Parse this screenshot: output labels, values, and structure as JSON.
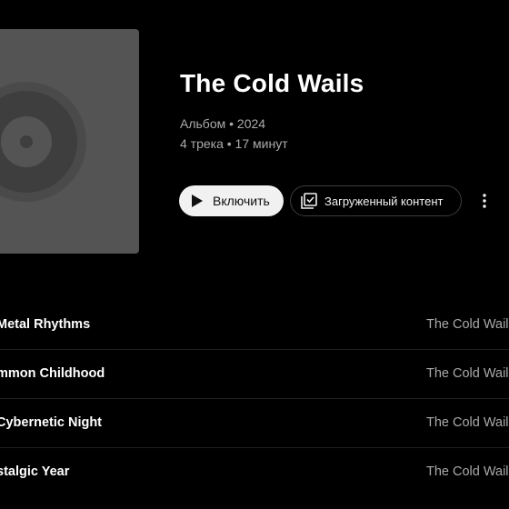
{
  "album": {
    "title": "The Cold Wails",
    "meta_line1": "Альбом • 2024",
    "meta_line2": "4 трека • 17 минут",
    "cover_icon": "vinyl-record-icon"
  },
  "actions": {
    "play_label": "Включить",
    "play_icon": "play-icon",
    "downloaded_label": "Загруженный контент",
    "downloaded_icon": "library-check-icon",
    "more_icon": "more-vertical-icon"
  },
  "tracks": [
    {
      "title": "Metal Rhythms",
      "artist": "The Cold Wails"
    },
    {
      "title": "mmon Childhood",
      "artist": "The Cold Wails"
    },
    {
      "title": "Cybernetic Night",
      "artist": "The Cold Wails"
    },
    {
      "title": "stalgic Year",
      "artist": "The Cold Wails"
    }
  ],
  "colors": {
    "background": "#000000",
    "cover": "#545454",
    "secondary_text": "#aaaaaa",
    "play_button": "#f1f1f1"
  }
}
